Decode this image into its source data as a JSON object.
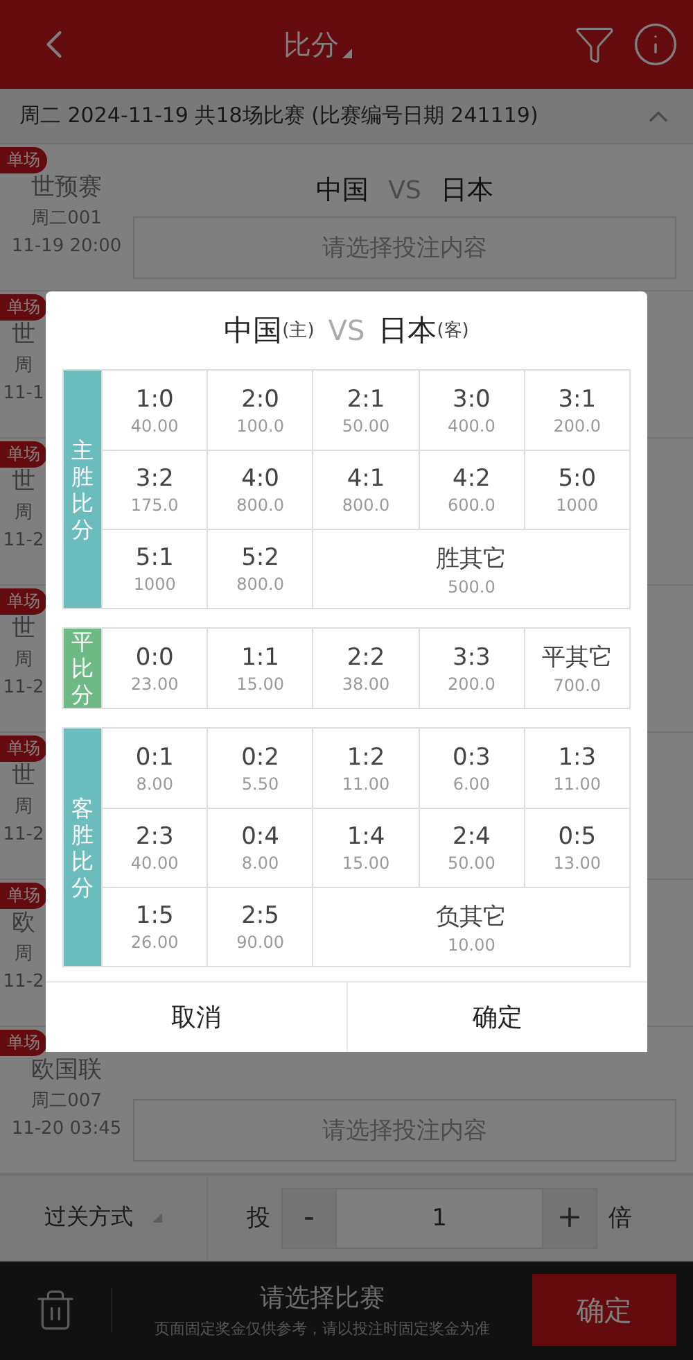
{
  "header": {
    "title": "比分"
  },
  "date_bar": {
    "text": "周二 2024-11-19 共18场比赛 (比赛编号日期 241119)",
    "expanded": true
  },
  "matches": [
    {
      "badge": "单场",
      "league": "世预赛",
      "number": "周二001",
      "time": "11-19 20:00",
      "home": "中国",
      "vs": "VS",
      "away": "日本",
      "prompt": "请选择投注内容"
    },
    {
      "badge": "单场",
      "league": "世",
      "number": "周",
      "time": "11-1"
    },
    {
      "badge": "单场",
      "league": "世",
      "number": "周",
      "time": "11-2"
    },
    {
      "badge": "单场",
      "league": "世",
      "number": "周",
      "time": "11-2"
    },
    {
      "badge": "单场",
      "league": "世",
      "number": "周",
      "time": "11-2"
    },
    {
      "badge": "单场",
      "league": "欧",
      "number": "周",
      "time": "11-2"
    },
    {
      "badge": "单场",
      "league": "欧国联",
      "number": "周二007",
      "time": "11-20 03:45",
      "prompt": "请选择投注内容"
    }
  ],
  "bet_bar": {
    "pass_mode": "过关方式",
    "label": "投",
    "minus": "-",
    "value": "1",
    "plus": "+",
    "unit": "倍"
  },
  "footer": {
    "title": "请选择比赛",
    "note": "页面固定奖金仅供参考，请以投注时固定奖金为准",
    "confirm": "确定"
  },
  "dialog": {
    "home": "中国",
    "home_tag": "(主)",
    "vs": "VS",
    "away": "日本",
    "away_tag": "(客)",
    "groups": [
      {
        "label": "主胜比分",
        "kind": "win",
        "cells": [
          {
            "score": "1:0",
            "odds": "40.00",
            "kind": "single",
            "selected": false
          },
          {
            "score": "2:0",
            "odds": "100.0",
            "kind": "single",
            "selected": false
          },
          {
            "score": "2:1",
            "odds": "50.00",
            "kind": "single",
            "selected": false
          },
          {
            "score": "3:0",
            "odds": "400.0",
            "kind": "single",
            "selected": false
          },
          {
            "score": "3:1",
            "odds": "200.0",
            "kind": "single",
            "selected": false
          },
          {
            "score": "3:2",
            "odds": "175.0",
            "kind": "single",
            "selected": false
          },
          {
            "score": "4:0",
            "odds": "800.0",
            "kind": "single",
            "selected": false
          },
          {
            "score": "4:1",
            "odds": "800.0",
            "kind": "single",
            "selected": false
          },
          {
            "score": "4:2",
            "odds": "600.0",
            "kind": "single",
            "selected": false
          },
          {
            "score": "5:0",
            "odds": "1000",
            "kind": "single",
            "selected": false
          },
          {
            "score": "5:1",
            "odds": "1000",
            "kind": "single",
            "selected": false
          },
          {
            "score": "5:2",
            "odds": "800.0",
            "kind": "single",
            "selected": false
          },
          {
            "score": "胜其它",
            "odds": "500.0",
            "kind": "wide",
            "selected": false
          }
        ]
      },
      {
        "label": "平比分",
        "kind": "draw",
        "cells": [
          {
            "score": "0:0",
            "odds": "23.00",
            "kind": "single",
            "selected": false
          },
          {
            "score": "1:1",
            "odds": "15.00",
            "kind": "single",
            "selected": false
          },
          {
            "score": "2:2",
            "odds": "38.00",
            "kind": "single",
            "selected": false
          },
          {
            "score": "3:3",
            "odds": "200.0",
            "kind": "single",
            "selected": false
          },
          {
            "score": "平其它",
            "odds": "700.0",
            "kind": "single",
            "selected": false
          }
        ]
      },
      {
        "label": "客胜比分",
        "kind": "win",
        "cells": [
          {
            "score": "0:1",
            "odds": "8.00",
            "kind": "single",
            "selected": false
          },
          {
            "score": "0:2",
            "odds": "5.50",
            "kind": "single",
            "selected": false
          },
          {
            "score": "1:2",
            "odds": "11.00",
            "kind": "single",
            "selected": false
          },
          {
            "score": "0:3",
            "odds": "6.00",
            "kind": "single",
            "selected": false
          },
          {
            "score": "1:3",
            "odds": "11.00",
            "kind": "single",
            "selected": false
          },
          {
            "score": "2:3",
            "odds": "40.00",
            "kind": "single",
            "selected": false
          },
          {
            "score": "0:4",
            "odds": "8.00",
            "kind": "single",
            "selected": false
          },
          {
            "score": "1:4",
            "odds": "15.00",
            "kind": "single",
            "selected": false
          },
          {
            "score": "2:4",
            "odds": "50.00",
            "kind": "single",
            "selected": false
          },
          {
            "score": "0:5",
            "odds": "13.00",
            "kind": "single",
            "selected": false
          },
          {
            "score": "1:5",
            "odds": "26.00",
            "kind": "single",
            "selected": false
          },
          {
            "score": "2:5",
            "odds": "90.00",
            "kind": "single",
            "selected": false
          },
          {
            "score": "负其它",
            "odds": "10.00",
            "kind": "wide",
            "selected": false
          }
        ]
      }
    ],
    "buttons": [
      "取消",
      "确定"
    ]
  }
}
